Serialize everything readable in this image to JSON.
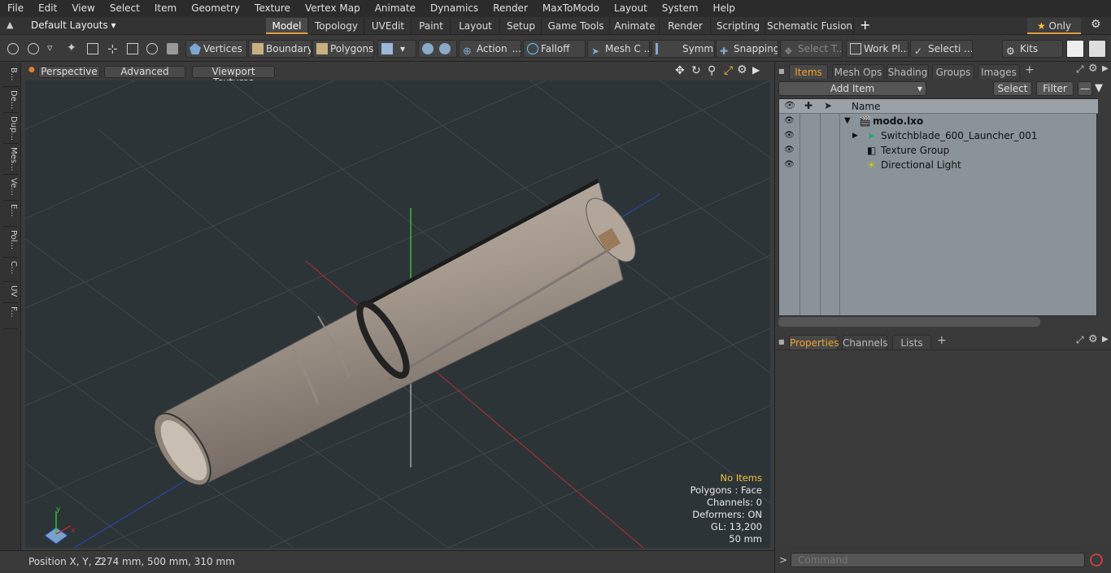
{
  "menu": [
    "File",
    "Edit",
    "View",
    "Select",
    "Item",
    "Geometry",
    "Texture",
    "Vertex Map",
    "Animate",
    "Dynamics",
    "Render",
    "MaxToModo",
    "Layout",
    "System",
    "Help"
  ],
  "layout_dropdown": "Default Layouts",
  "layout_tabs": [
    "Model",
    "Topology",
    "UVEdit",
    "Paint",
    "Layout",
    "Setup",
    "Game Tools",
    "Animate",
    "Render",
    "Scripting",
    "Schematic Fusion"
  ],
  "only_label": "Only",
  "toolbar": {
    "vertices": "Vertices",
    "boundary": "Boundary",
    "polygons": "Polygons",
    "action": "Action",
    "falloff": "Falloff",
    "mesh": "Mesh C ...",
    "symm": "Symm ...",
    "snapping": "Snapping",
    "select_t": "Select T...",
    "work_pl": "Work Pl...",
    "selecti": "Selecti ...",
    "kits": "Kits"
  },
  "left_tabs": [
    "B...",
    "De...",
    "Dup...",
    "Mes...",
    "Ve...",
    "E...",
    "Pol...",
    "C...",
    "UV",
    "F..."
  ],
  "viewport": {
    "perspective": "Perspective",
    "advanced": "Advanced",
    "viewport_textures": "Viewport Textures",
    "info": {
      "no_items": "No Items",
      "polygons": "Polygons : Face",
      "channels": "Channels: 0",
      "deformers": "Deformers: ON",
      "gl": "GL: 13,200",
      "scale": "50 mm"
    }
  },
  "status": {
    "label": "Position X, Y, Z:",
    "value": "-274 mm, 500 mm, 310 mm"
  },
  "items_panel": {
    "tabs": [
      "Items",
      "Mesh Ops",
      "Shading",
      "Groups",
      "Images"
    ],
    "add_item": "Add Item",
    "select": "Select",
    "filter": "Filter",
    "name_header": "Name",
    "rows": [
      "modo.lxo",
      "Switchblade_600_Launcher_001",
      "Texture Group",
      "Directional Light"
    ]
  },
  "props_panel": {
    "tabs": [
      "Properties",
      "Channels",
      "Lists"
    ]
  },
  "command_placeholder": "Command",
  "colors": {
    "accent": "#f0a030",
    "viewport_bg": "#2d3438",
    "info_yellow": "#f0c040"
  }
}
